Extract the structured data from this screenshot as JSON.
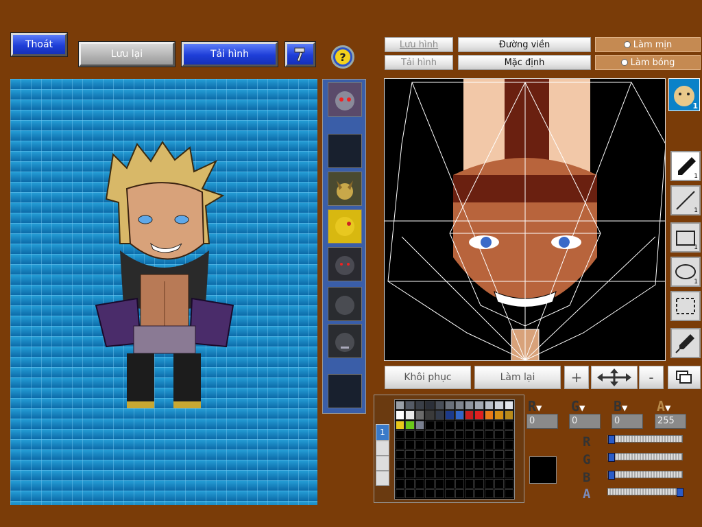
{
  "top_buttons": {
    "exit": "Thoát",
    "save": "Lưu lại",
    "reload": "Tải hình",
    "help": "?"
  },
  "editor_buttons": {
    "save_image": "Lưu hình",
    "load_image": "Tải hình",
    "outline": "Đường viền",
    "default": "Mặc định",
    "smooth": "Làm mịn",
    "shine": "Làm bóng"
  },
  "action_buttons": {
    "restore": "Khôi phục",
    "redo": "Làm lại",
    "plus": "+",
    "minus": "-"
  },
  "face_tab_badge": "1",
  "tool_badges": [
    "1",
    "1",
    "1",
    "1"
  ],
  "color_channels": {
    "labels": [
      "R",
      "G",
      "B",
      "A"
    ],
    "values": [
      "0",
      "0",
      "0",
      "255"
    ],
    "slider_levels": [
      0,
      0,
      0,
      1.0
    ]
  },
  "palette_colors": [
    "#9aa0a8",
    "#555b66",
    "#3a3f48",
    "#2b2f38",
    "#484e58",
    "#6a707a",
    "#7e848e",
    "#8e949e",
    "#a2a8b2",
    "#b8bec8",
    "#cfd4dc",
    "#e2e6ec",
    "#ffffff",
    "#e9e9e9",
    "#6a6a6a",
    "#3a3a3a",
    "#323a4a",
    "#1c3a8a",
    "#3266c8",
    "#c81e1e",
    "#e02020",
    "#e87a18",
    "#d48e14",
    "#b88a1a",
    "#e8c81a",
    "#6ac81a",
    "#7a8090"
  ],
  "palette_tab_label": "1",
  "current_color": "#000000"
}
